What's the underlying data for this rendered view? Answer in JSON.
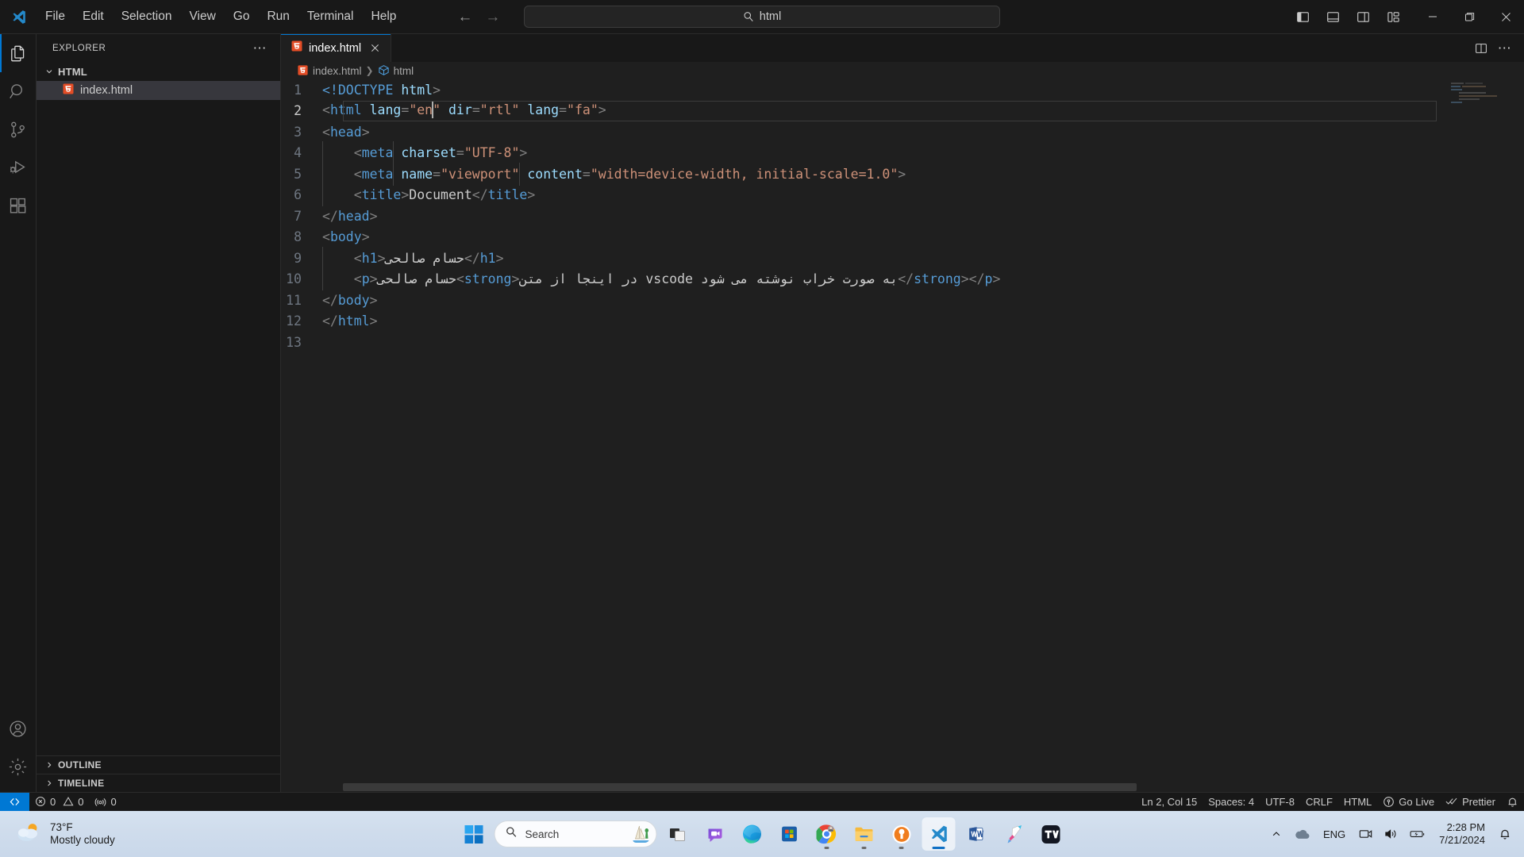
{
  "titlebar": {
    "logo_icon": "vscode-logo-icon",
    "menus": [
      "File",
      "Edit",
      "Selection",
      "View",
      "Go",
      "Run",
      "Terminal",
      "Help"
    ],
    "nav_back_icon": "arrow-left-icon",
    "nav_forward_icon": "arrow-right-icon",
    "search": {
      "icon": "search-icon",
      "value": "html",
      "placeholder": "Search"
    },
    "layout_buttons": [
      {
        "name": "toggle-primary-sidebar",
        "icon": "layout-sidebar-left-icon"
      },
      {
        "name": "toggle-panel",
        "icon": "layout-panel-icon"
      },
      {
        "name": "toggle-secondary-sidebar",
        "icon": "layout-sidebar-right-icon"
      },
      {
        "name": "customize-layout",
        "icon": "layout-customize-icon"
      }
    ],
    "window_buttons": [
      {
        "name": "minimize-button",
        "icon": "minimize-icon"
      },
      {
        "name": "maximize-button",
        "icon": "maximize-icon"
      },
      {
        "name": "close-button",
        "icon": "close-icon"
      }
    ]
  },
  "activitybar": {
    "items": [
      {
        "name": "explorer",
        "icon": "files-icon",
        "active": true
      },
      {
        "name": "search",
        "icon": "search-icon",
        "active": false
      },
      {
        "name": "source-control",
        "icon": "source-control-icon",
        "active": false
      },
      {
        "name": "run-and-debug",
        "icon": "debug-icon",
        "active": false
      },
      {
        "name": "extensions",
        "icon": "extensions-icon",
        "active": false
      }
    ],
    "bottom": [
      {
        "name": "accounts",
        "icon": "account-icon"
      },
      {
        "name": "manage-settings",
        "icon": "gear-icon"
      }
    ]
  },
  "sidebar": {
    "title": "EXPLORER",
    "more_actions_icon": "ellipsis-icon",
    "folder": {
      "label": "HTML",
      "expanded": true,
      "chevron_icon": "chevron-down-icon"
    },
    "files": [
      {
        "label": "index.html",
        "icon": "html5-file-icon",
        "selected": true
      }
    ],
    "panes": [
      {
        "label": "OUTLINE",
        "chevron_icon": "chevron-right-icon"
      },
      {
        "label": "TIMELINE",
        "chevron_icon": "chevron-right-icon"
      }
    ]
  },
  "editor": {
    "tab": {
      "label": "index.html",
      "icon": "html5-file-icon",
      "close_icon": "close-icon"
    },
    "actions": [
      {
        "name": "split-editor-right",
        "icon": "split-editor-icon"
      },
      {
        "name": "more-editor-actions",
        "icon": "ellipsis-icon"
      }
    ],
    "breadcrumb": [
      {
        "label": "index.html",
        "icon": "html5-file-icon"
      },
      {
        "label": "html",
        "icon": "symbol-structure-icon"
      }
    ],
    "cursor_line": 2,
    "lines": [
      {
        "n": 1,
        "tokens": [
          {
            "t": "<!DOCTYPE",
            "c": "doctype"
          },
          {
            "t": " ",
            "c": "txt"
          },
          {
            "t": "html",
            "c": "attr"
          },
          {
            "t": ">",
            "c": "brk"
          }
        ]
      },
      {
        "n": 2,
        "tokens": [
          {
            "t": "<",
            "c": "brk"
          },
          {
            "t": "html",
            "c": "tag"
          },
          {
            "t": " ",
            "c": "txt"
          },
          {
            "t": "lang",
            "c": "attr"
          },
          {
            "t": "=",
            "c": "brk"
          },
          {
            "t": "\"en",
            "c": "str"
          },
          {
            "t": "CARET",
            "c": "caret"
          },
          {
            "t": "\"",
            "c": "str"
          },
          {
            "t": " ",
            "c": "txt"
          },
          {
            "t": "dir",
            "c": "attr"
          },
          {
            "t": "=",
            "c": "brk"
          },
          {
            "t": "\"rtl\"",
            "c": "str"
          },
          {
            "t": " ",
            "c": "txt"
          },
          {
            "t": "lang",
            "c": "attr"
          },
          {
            "t": "=",
            "c": "brk"
          },
          {
            "t": "\"fa\"",
            "c": "str"
          },
          {
            "t": ">",
            "c": "brk"
          }
        ]
      },
      {
        "n": 3,
        "tokens": [
          {
            "t": "<",
            "c": "brk"
          },
          {
            "t": "head",
            "c": "tag"
          },
          {
            "t": ">",
            "c": "brk"
          }
        ]
      },
      {
        "n": 4,
        "indent": 1,
        "tokens": [
          {
            "t": "    ",
            "c": "txt"
          },
          {
            "t": "<",
            "c": "brk"
          },
          {
            "t": "meta",
            "c": "tag"
          },
          {
            "t": " ",
            "c": "txt"
          },
          {
            "t": "charset",
            "c": "attr"
          },
          {
            "t": "=",
            "c": "brk"
          },
          {
            "t": "\"UTF-8\"",
            "c": "str"
          },
          {
            "t": ">",
            "c": "brk"
          }
        ]
      },
      {
        "n": 5,
        "indent": 1,
        "tokens": [
          {
            "t": "    ",
            "c": "txt"
          },
          {
            "t": "<",
            "c": "brk"
          },
          {
            "t": "meta",
            "c": "tag"
          },
          {
            "t": " ",
            "c": "txt"
          },
          {
            "t": "name",
            "c": "attr"
          },
          {
            "t": "=",
            "c": "brk"
          },
          {
            "t": "\"viewport\"",
            "c": "str"
          },
          {
            "t": " ",
            "c": "txt"
          },
          {
            "t": "content",
            "c": "attr"
          },
          {
            "t": "=",
            "c": "brk"
          },
          {
            "t": "\"width=device-width, initial-scale=1.0\"",
            "c": "str"
          },
          {
            "t": ">",
            "c": "brk"
          }
        ]
      },
      {
        "n": 6,
        "indent": 1,
        "tokens": [
          {
            "t": "    ",
            "c": "txt"
          },
          {
            "t": "<",
            "c": "brk"
          },
          {
            "t": "title",
            "c": "tag"
          },
          {
            "t": ">",
            "c": "brk"
          },
          {
            "t": "Document",
            "c": "txt"
          },
          {
            "t": "</",
            "c": "brk"
          },
          {
            "t": "title",
            "c": "tag"
          },
          {
            "t": ">",
            "c": "brk"
          }
        ]
      },
      {
        "n": 7,
        "tokens": [
          {
            "t": "</",
            "c": "brk"
          },
          {
            "t": "head",
            "c": "tag"
          },
          {
            "t": ">",
            "c": "brk"
          }
        ]
      },
      {
        "n": 8,
        "tokens": [
          {
            "t": "<",
            "c": "brk"
          },
          {
            "t": "body",
            "c": "tag"
          },
          {
            "t": ">",
            "c": "brk"
          }
        ]
      },
      {
        "n": 9,
        "indent": 1,
        "tokens": [
          {
            "t": "    ",
            "c": "txt"
          },
          {
            "t": "<",
            "c": "brk"
          },
          {
            "t": "h1",
            "c": "tag"
          },
          {
            "t": ">",
            "c": "brk"
          },
          {
            "t": "حسام صالحی",
            "c": "rtl"
          },
          {
            "t": "</",
            "c": "brk"
          },
          {
            "t": "h1",
            "c": "tag"
          },
          {
            "t": ">",
            "c": "brk"
          }
        ]
      },
      {
        "n": 10,
        "indent": 1,
        "tokens": [
          {
            "t": "    ",
            "c": "txt"
          },
          {
            "t": "<",
            "c": "brk"
          },
          {
            "t": "p",
            "c": "tag"
          },
          {
            "t": ">",
            "c": "brk"
          },
          {
            "t": "حسام صالحی",
            "c": "rtl"
          },
          {
            "t": "<",
            "c": "brk"
          },
          {
            "t": "strong",
            "c": "tag"
          },
          {
            "t": ">",
            "c": "brk"
          },
          {
            "t": "در اینجا از متن vscode به صورت خراب نوشته می شود",
            "c": "rtl"
          },
          {
            "t": "</",
            "c": "brk"
          },
          {
            "t": "strong",
            "c": "tag"
          },
          {
            "t": ">",
            "c": "brk"
          },
          {
            "t": "</",
            "c": "brk"
          },
          {
            "t": "p",
            "c": "tag"
          },
          {
            "t": ">",
            "c": "brk"
          }
        ]
      },
      {
        "n": 11,
        "tokens": [
          {
            "t": "</",
            "c": "brk"
          },
          {
            "t": "body",
            "c": "tag"
          },
          {
            "t": ">",
            "c": "brk"
          }
        ]
      },
      {
        "n": 12,
        "tokens": [
          {
            "t": "</",
            "c": "brk"
          },
          {
            "t": "html",
            "c": "tag"
          },
          {
            "t": ">",
            "c": "brk"
          }
        ]
      },
      {
        "n": 13,
        "tokens": []
      }
    ]
  },
  "statusbar": {
    "remote": {
      "icon": "remote-icon",
      "label": ""
    },
    "left": [
      {
        "name": "problems",
        "icon": "error-icon",
        "label": "0",
        "icon2": "warning-icon",
        "label2": "0"
      },
      {
        "name": "ports",
        "icon": "ports-icon",
        "label": "0"
      }
    ],
    "errors": "0",
    "warnings": "0",
    "ports": "0",
    "right": [
      {
        "name": "editor-position",
        "label": "Ln 2, Col 15"
      },
      {
        "name": "editor-indentation",
        "label": "Spaces: 4"
      },
      {
        "name": "editor-encoding",
        "label": "UTF-8"
      },
      {
        "name": "editor-eol",
        "label": "CRLF"
      },
      {
        "name": "editor-language",
        "label": "HTML"
      },
      {
        "name": "go-live",
        "label": "Go Live",
        "icon": "broadcast-icon"
      },
      {
        "name": "prettier",
        "label": "Prettier",
        "icon": "check-all-icon"
      }
    ],
    "notifications_icon": "bell-icon"
  },
  "taskbar": {
    "weather": {
      "temp": "73°F",
      "desc": "Mostly cloudy",
      "icon": "partly-cloudy-icon"
    },
    "start_icon": "windows-start-icon",
    "search": {
      "placeholder": "Search",
      "icon": "search-icon"
    },
    "apps": [
      {
        "name": "task-view",
        "icon": "task-view-icon",
        "running": false,
        "active": false
      },
      {
        "name": "chat",
        "icon": "chat-icon",
        "running": false,
        "active": false
      },
      {
        "name": "microsoft-edge",
        "icon": "edge-icon",
        "running": false,
        "active": false
      },
      {
        "name": "microsoft-store",
        "icon": "store-icon",
        "running": false,
        "active": false
      },
      {
        "name": "google-chrome",
        "icon": "chrome-icon",
        "running": true,
        "active": false
      },
      {
        "name": "file-explorer",
        "icon": "folder-icon",
        "running": true,
        "active": false
      },
      {
        "name": "openvpn",
        "icon": "openvpn-icon",
        "running": true,
        "active": false
      },
      {
        "name": "visual-studio-code",
        "icon": "vscode-icon",
        "running": true,
        "active": true
      },
      {
        "name": "microsoft-word",
        "icon": "word-icon",
        "running": false,
        "active": false
      },
      {
        "name": "telegram-premium",
        "icon": "app-icon",
        "running": false,
        "active": false
      },
      {
        "name": "tradingview",
        "icon": "tradingview-icon",
        "running": false,
        "active": false
      }
    ],
    "tray": {
      "chevron_icon": "chevron-up-icon",
      "onedrive_icon": "cloud-icon",
      "language": "ENG",
      "network_icon": "network-icon",
      "volume_icon": "volume-icon",
      "battery_icon": "battery-icon",
      "notification_icon": "bell-icon",
      "time": "2:28 PM",
      "date": "7/21/2024"
    }
  },
  "colors": {
    "accent": "#0078d4",
    "editor_bg": "#1f1f1f",
    "chrome_bg": "#181818",
    "tag": "#569cd6",
    "attr": "#9cdcfe",
    "string": "#ce9178",
    "html_orange": "#e44d26"
  }
}
